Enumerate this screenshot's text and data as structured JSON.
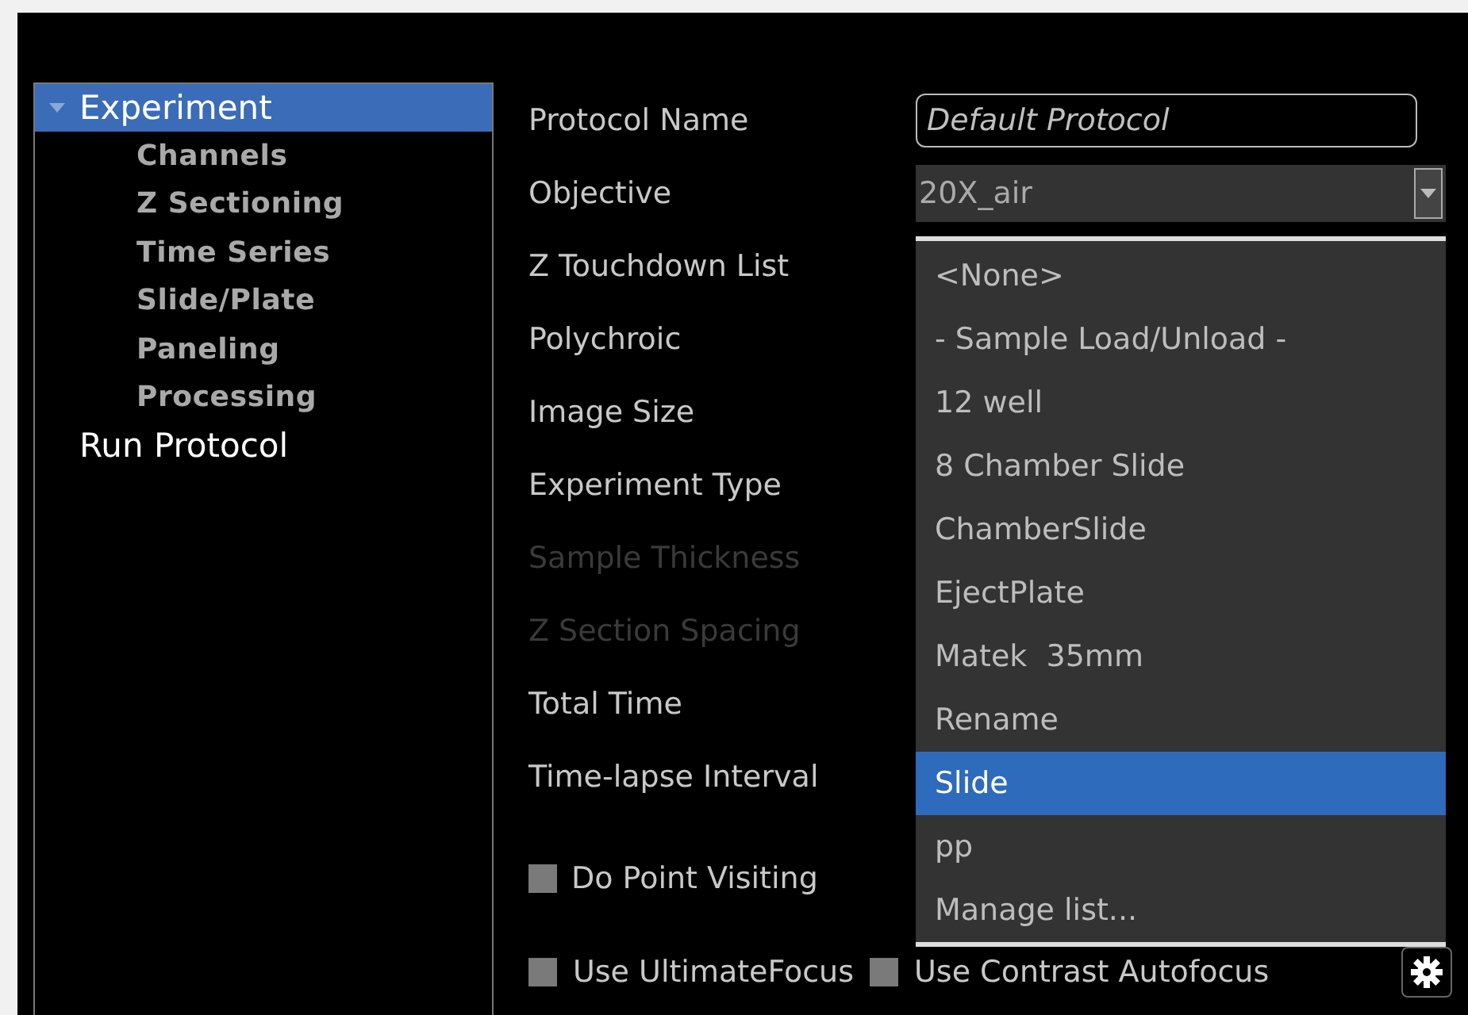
{
  "tree": [
    {
      "label": "Experiment",
      "selected": true,
      "expanded": true,
      "children": [
        {
          "label": "Channels",
          "selected": false
        },
        {
          "label": "Z Sectioning",
          "selected": false
        },
        {
          "label": "Time Series",
          "selected": false
        },
        {
          "label": "Slide/Plate",
          "selected": false
        },
        {
          "label": "Paneling",
          "selected": false
        },
        {
          "label": "Processing",
          "selected": false
        }
      ]
    },
    {
      "label": "Run Protocol",
      "selected": false
    }
  ],
  "fields": [
    {
      "label": "Protocol Name",
      "disabled": false,
      "kind": "input",
      "value": "Default Protocol"
    },
    {
      "label": "Objective",
      "disabled": false,
      "kind": "combo",
      "value": "20X_air"
    },
    {
      "label": "Z Touchdown List",
      "disabled": false
    },
    {
      "label": "Polychroic",
      "disabled": false
    },
    {
      "label": "Image Size",
      "disabled": false
    },
    {
      "label": "Experiment Type",
      "disabled": false
    },
    {
      "label": "Sample Thickness",
      "disabled": true
    },
    {
      "label": "Z Section Spacing",
      "disabled": true
    },
    {
      "label": "Total Time",
      "disabled": false
    },
    {
      "label": "Time-lapse Interval",
      "disabled": false
    }
  ],
  "checkboxes": [
    {
      "label": "Do Point Visiting",
      "checked": false
    }
  ],
  "bottom_row": [
    {
      "label": "Use UltimateFocus",
      "checked": false
    },
    {
      "label": "Use Contrast Autofocus",
      "checked": false
    }
  ],
  "dropdown": [
    {
      "label": "<None>",
      "selected": false
    },
    {
      "label": "- Sample Load/Unload -",
      "selected": false
    },
    {
      "label": "12 well",
      "selected": false
    },
    {
      "label": "8 Chamber Slide",
      "selected": false
    },
    {
      "label": "ChamberSlide",
      "selected": false
    },
    {
      "label": "EjectPlate",
      "selected": false
    },
    {
      "label": "Matek  35mm",
      "selected": false
    },
    {
      "label": "Rename",
      "selected": false
    },
    {
      "label": "Slide",
      "selected": true
    },
    {
      "label": "pp",
      "selected": false
    },
    {
      "label": "Manage list...",
      "selected": false
    }
  ]
}
